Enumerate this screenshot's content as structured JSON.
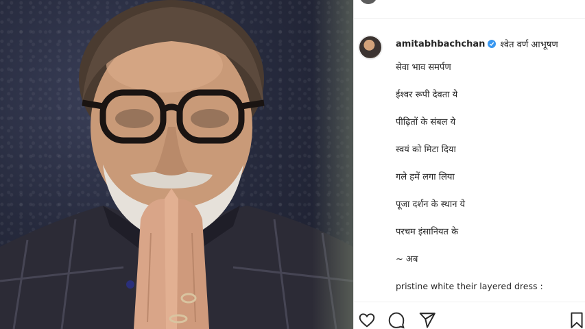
{
  "post": {
    "username": "amitabhbachchan",
    "caption_title": "श्वेत वर्ण आभूषण",
    "poem_lines": [
      "सेवा भाव समर्पण",
      "ईश्वर रूपी देवता ये",
      "पीढ़ितों के संबल ये",
      "स्वयं को मिटा दिया",
      "गले हमें लगा लिया",
      "पूजा दर्शन के स्थान ये",
      "परचम इंसानियत के",
      "~ अब"
    ],
    "english_line": "pristine white their layered dress :"
  },
  "icons": {
    "verified": "verified-badge-icon",
    "like": "heart-icon",
    "comment": "comment-bubble-icon",
    "share": "paper-plane-icon",
    "save": "bookmark-icon"
  },
  "colors": {
    "verified_blue": "#3897f0",
    "text": "#262626",
    "divider": "#efefef"
  }
}
